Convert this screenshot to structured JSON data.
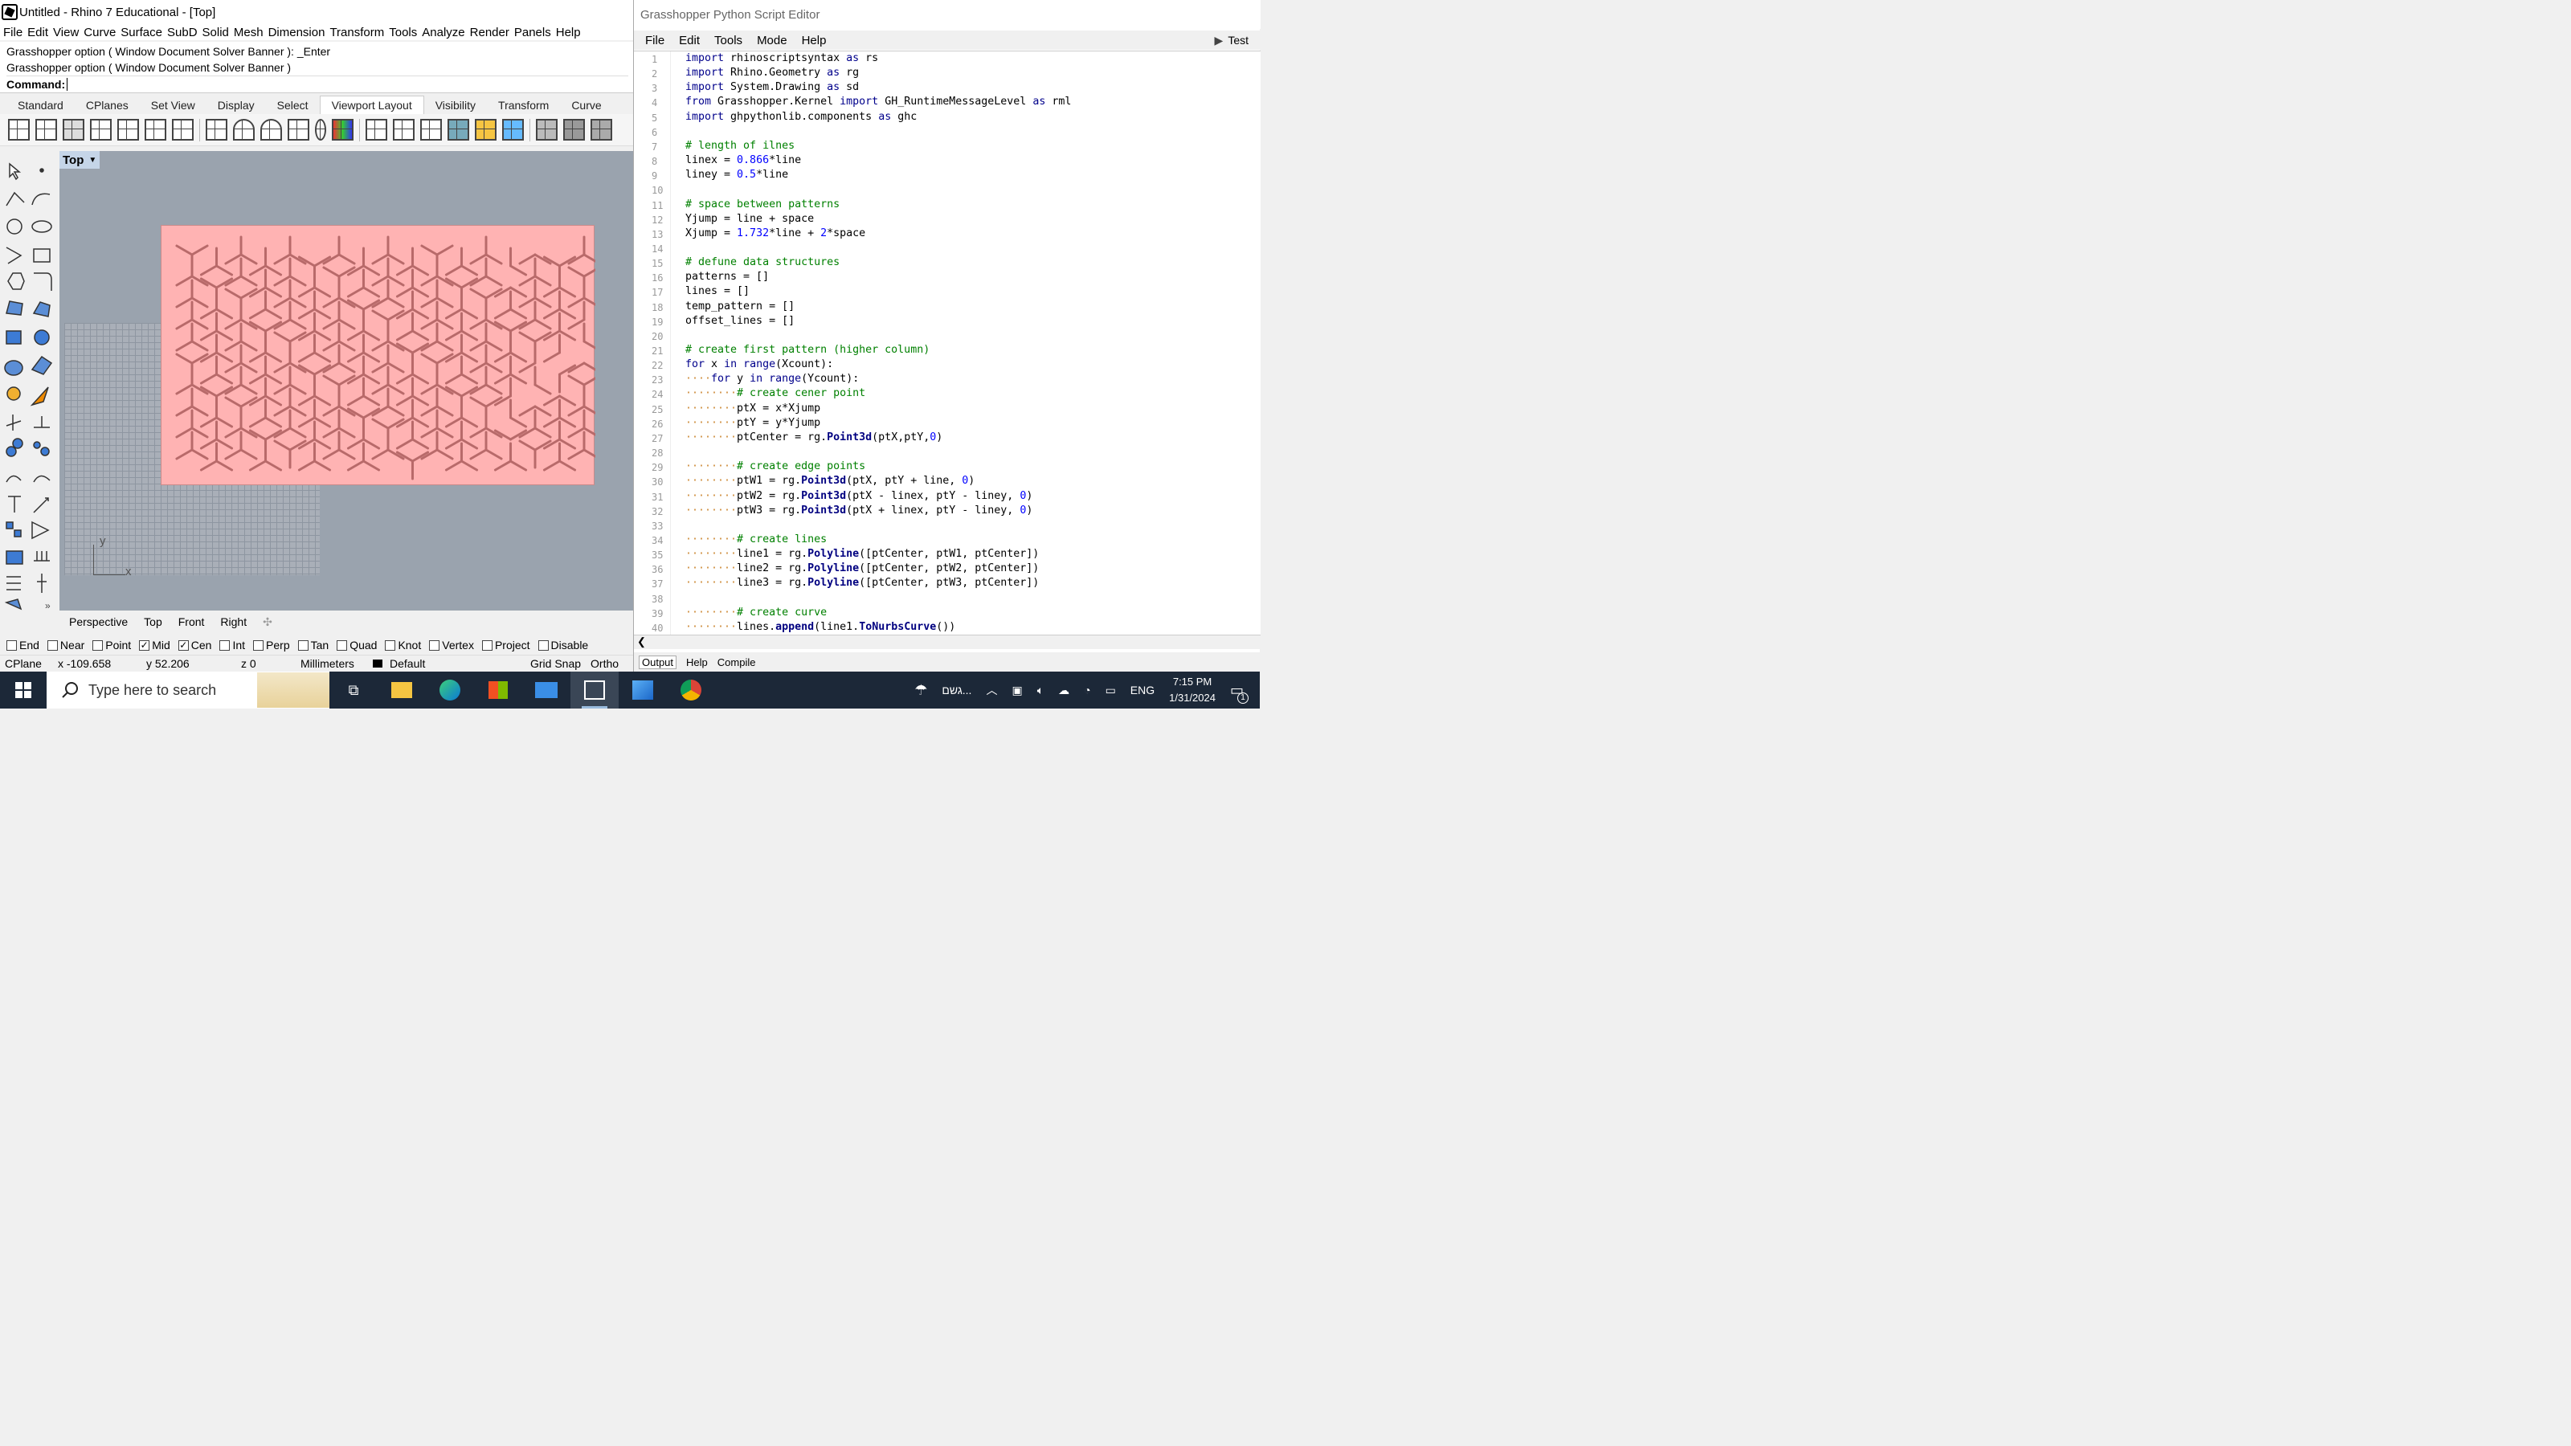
{
  "rhino": {
    "title": "Untitled - Rhino 7 Educational - [Top]",
    "menu": [
      "File",
      "Edit",
      "View",
      "Curve",
      "Surface",
      "SubD",
      "Solid",
      "Mesh",
      "Dimension",
      "Transform",
      "Tools",
      "Analyze",
      "Render",
      "Panels",
      "Help"
    ],
    "history": [
      "Grasshopper option ( Window  Document  Solver  Banner ): _Enter",
      "Grasshopper option ( Window  Document  Solver  Banner )"
    ],
    "command_label": "Command:",
    "tabs": [
      "Standard",
      "CPlanes",
      "Set View",
      "Display",
      "Select",
      "Viewport Layout",
      "Visibility",
      "Transform",
      "Curve"
    ],
    "active_tab": "Viewport Layout",
    "viewport_label": "Top",
    "axis_y": "y",
    "axis_x": "x",
    "viewport_tabs": [
      "Perspective",
      "Top",
      "Front",
      "Right"
    ],
    "osnaps": [
      {
        "label": "End",
        "checked": false
      },
      {
        "label": "Near",
        "checked": false
      },
      {
        "label": "Point",
        "checked": false
      },
      {
        "label": "Mid",
        "checked": true
      },
      {
        "label": "Cen",
        "checked": true
      },
      {
        "label": "Int",
        "checked": false
      },
      {
        "label": "Perp",
        "checked": false
      },
      {
        "label": "Tan",
        "checked": false
      },
      {
        "label": "Quad",
        "checked": false
      },
      {
        "label": "Knot",
        "checked": false
      },
      {
        "label": "Vertex",
        "checked": false
      },
      {
        "label": "Project",
        "checked": false
      },
      {
        "label": "Disable",
        "checked": false
      }
    ],
    "status": {
      "cplane": "CPlane",
      "x": "x -109.658",
      "y": "y 52.206",
      "z": "z 0",
      "units": "Millimeters",
      "layer": "Default",
      "grid_snap": "Grid Snap",
      "ortho": "Ortho"
    },
    "pattern_color": "#ffb3b3"
  },
  "editor": {
    "title": "Grasshopper Python Script Editor",
    "menu": [
      "File",
      "Edit",
      "Tools",
      "Mode",
      "Help"
    ],
    "test_label": "Test",
    "bottom_tabs": [
      "Output",
      "Help",
      "Compile"
    ],
    "code_lines": [
      "import rhinoscriptsyntax as rs",
      "import Rhino.Geometry as rg",
      "import System.Drawing as sd",
      "from Grasshopper.Kernel import GH_RuntimeMessageLevel as rml",
      "import ghpythonlib.components as ghc",
      "",
      "# length of ilnes",
      "linex = 0.866*line",
      "liney = 0.5*line",
      "",
      "# space between patterns",
      "Yjump = line + space",
      "Xjump = 1.732*line + 2*space",
      "",
      "# defune data structures",
      "patterns = []",
      "lines = []",
      "temp_pattern = []",
      "offset_lines = []",
      "",
      "# create first pattern (higher column)",
      "for x in range(Xcount):",
      "    for y in range(Ycount):",
      "        # create cener point",
      "        ptX = x*Xjump",
      "        ptY = y*Yjump",
      "        ptCenter = rg.Point3d(ptX,ptY,0)",
      "",
      "        # create edge points",
      "        ptW1 = rg.Point3d(ptX, ptY + line, 0)",
      "        ptW2 = rg.Point3d(ptX - linex, ptY - liney, 0)",
      "        ptW3 = rg.Point3d(ptX + linex, ptY - liney, 0)",
      "",
      "        # create lines",
      "        line1 = rg.Polyline([ptCenter, ptW1, ptCenter])",
      "        line2 = rg.Polyline([ptCenter, ptW2, ptCenter])",
      "        line3 = rg.Polyline([ptCenter, ptW3, ptCenter])",
      "",
      "        # create curve",
      "        lines.append(line1.ToNurbsCurve())"
    ]
  },
  "taskbar": {
    "search_placeholder": "Type here to search",
    "weather": "גשם...",
    "language": "ENG",
    "time": "7:15 PM",
    "date": "1/31/2024",
    "notifications": "1"
  }
}
